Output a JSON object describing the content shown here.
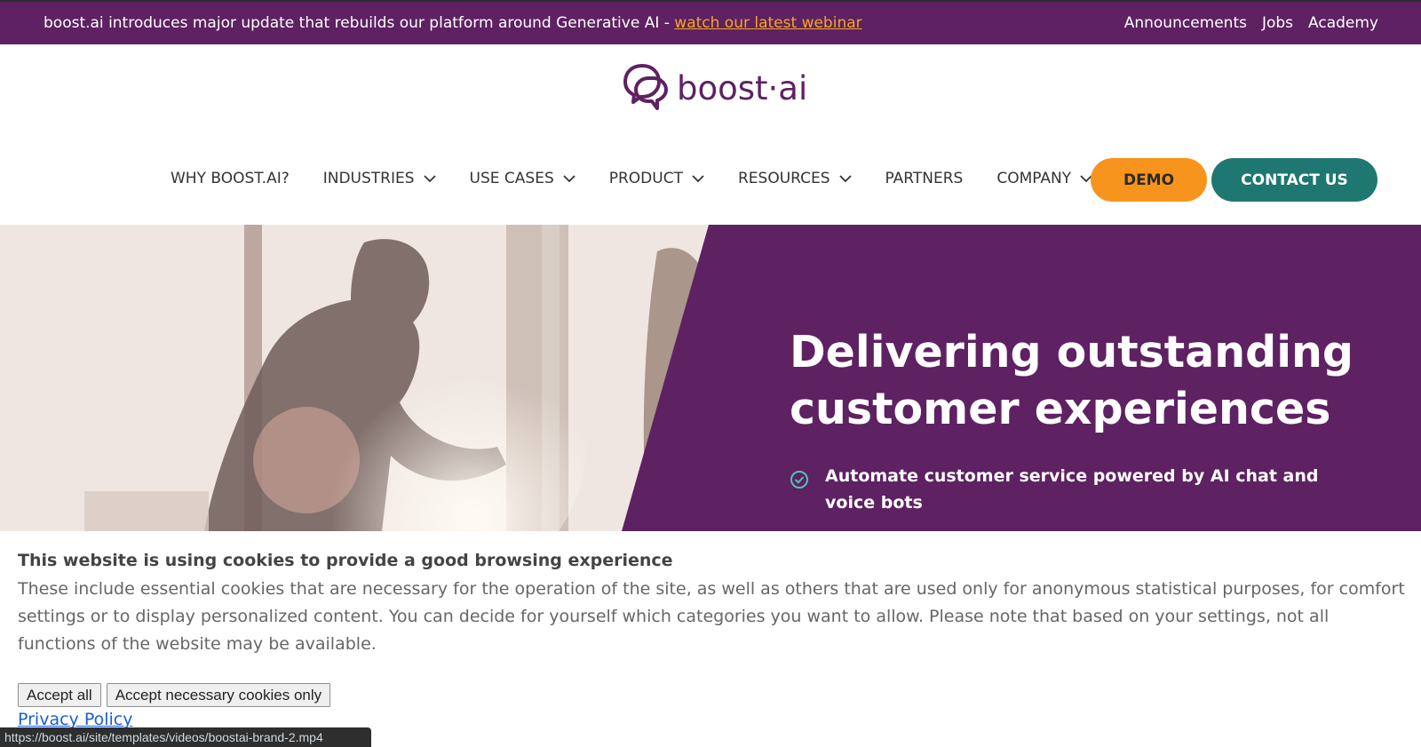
{
  "announcement": {
    "message": "boost.ai introduces major update that rebuilds our platform around Generative AI - ",
    "link_text": "watch our latest webinar",
    "links": [
      "Announcements",
      "Jobs",
      "Academy"
    ]
  },
  "logo": {
    "wordmark": "boost·ai"
  },
  "nav": {
    "items": [
      {
        "label": "WHY BOOST.AI?",
        "dropdown": false
      },
      {
        "label": "INDUSTRIES",
        "dropdown": true
      },
      {
        "label": "USE CASES",
        "dropdown": true
      },
      {
        "label": "PRODUCT",
        "dropdown": true
      },
      {
        "label": "RESOURCES",
        "dropdown": true
      },
      {
        "label": "PARTNERS",
        "dropdown": false
      },
      {
        "label": "COMPANY",
        "dropdown": true
      }
    ],
    "demo_label": "DEMO",
    "contact_label": "CONTACT US"
  },
  "hero": {
    "heading": "Delivering outstanding customer experiences",
    "bullet": "Automate customer service powered by AI chat and voice bots"
  },
  "cookie": {
    "title": "This website is using cookies to provide a good browsing experience",
    "body": "These include essential cookies that are necessary for the operation of the site, as well as others that are used only for anonymous statistical purposes, for comfort settings or to display personalized content. You can decide for yourself which categories you want to allow. Please note that based on your settings, not all functions of the website may be available.",
    "accept_all": "Accept all",
    "accept_necessary": "Accept necessary cookies only",
    "privacy": "Privacy Policy"
  },
  "status_bar": {
    "url": "https://boost.ai/site/templates/videos/boostai-brand-2.mp4"
  },
  "colors": {
    "brand_purple": "#5e2162",
    "demo_orange": "#f7941d",
    "contact_teal": "#1e7770",
    "link_yellow": "#f5a623"
  },
  "icons": [
    "boost-logo-icon",
    "chevron-down-icon",
    "check-circle-icon"
  ]
}
